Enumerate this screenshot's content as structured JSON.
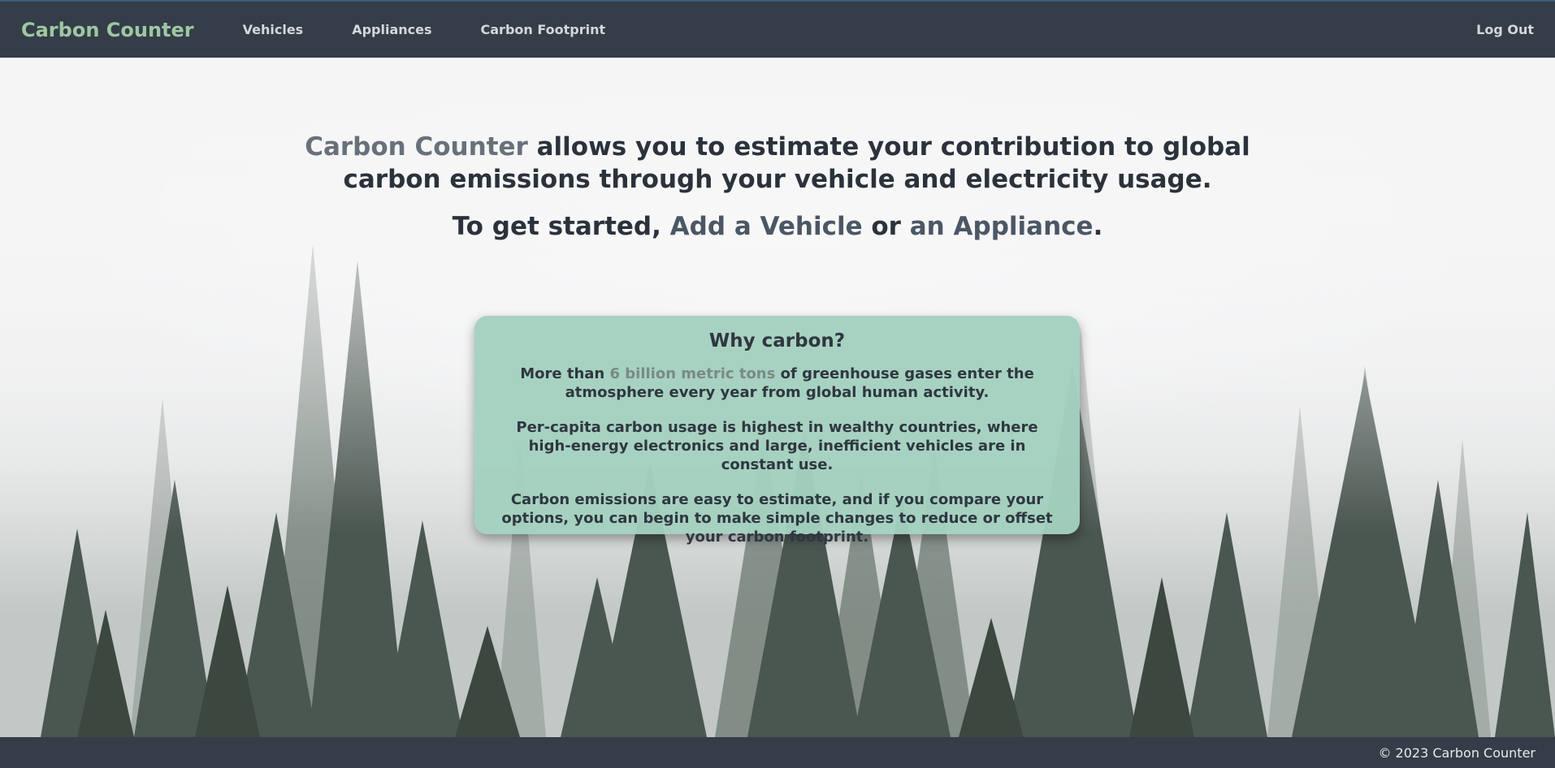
{
  "navbar": {
    "brand": "Carbon Counter",
    "links": [
      "Vehicles",
      "Appliances",
      "Carbon Footprint"
    ],
    "logout": "Log Out"
  },
  "hero": {
    "headline_accent": "Carbon Counter",
    "headline_rest": " allows you to estimate your contribution to global carbon emissions through your vehicle and electricity usage.",
    "subline_prefix": "To get started, ",
    "add_vehicle_link": "Add a Vehicle",
    "subline_or": " or ",
    "add_appliance_link": "an Appliance",
    "subline_suffix": "."
  },
  "info_card": {
    "title": "Why carbon?",
    "p1_prefix": "More than ",
    "p1_highlight": "6 billion metric tons",
    "p1_suffix": " of greenhouse gases enter the atmosphere every year from global human activity.",
    "p2": "Per-capita carbon usage is highest in wealthy countries, where high-energy electronics and large, inefficient vehicles are in constant use.",
    "p3": "Carbon emissions are easy to estimate, and if you compare your options, you can begin to make simple changes to reduce or offset your carbon footprint."
  },
  "footer": {
    "copyright": "© 2023 Carbon Counter"
  },
  "colors": {
    "navbar_bg": "#343d48",
    "brand": "#9ec7a3",
    "card_bg": "#a3d0be",
    "text_dark": "#2b323b"
  }
}
